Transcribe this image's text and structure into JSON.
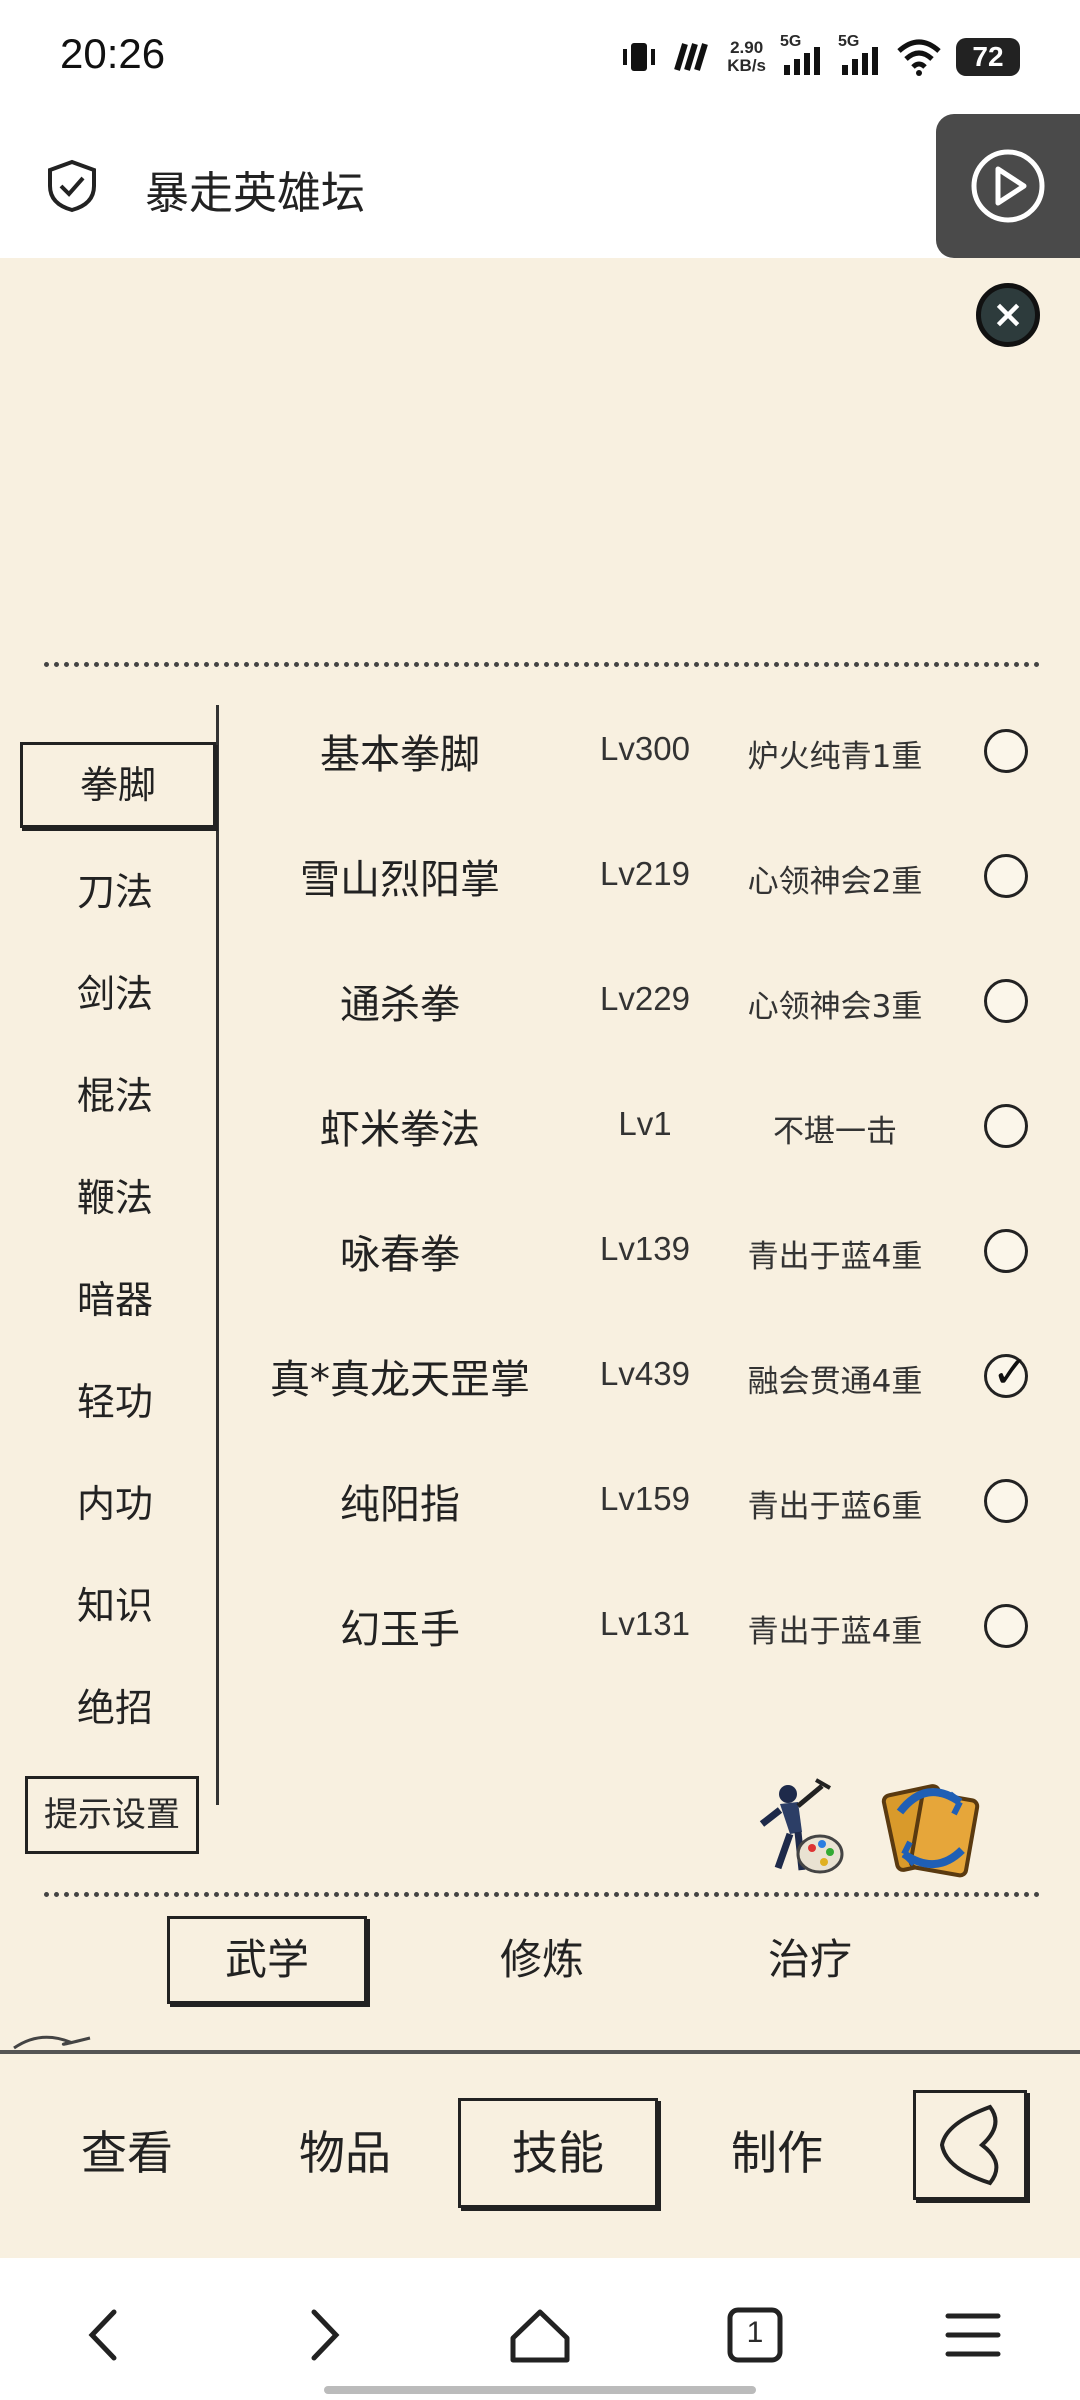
{
  "status_bar": {
    "time": "20:26",
    "net_speed": "2.90",
    "net_speed_unit": "KB/s",
    "signal1": "5G",
    "signal2": "5G",
    "battery": "72"
  },
  "app_bar": {
    "title": "暴走英雄坛",
    "icons": [
      "shield-check-icon",
      "play-circle-icon"
    ]
  },
  "categories": [
    {
      "label": "拳脚",
      "active": true
    },
    {
      "label": "刀法",
      "active": false
    },
    {
      "label": "剑法",
      "active": false
    },
    {
      "label": "棍法",
      "active": false
    },
    {
      "label": "鞭法",
      "active": false
    },
    {
      "label": "暗器",
      "active": false
    },
    {
      "label": "轻功",
      "active": false
    },
    {
      "label": "内功",
      "active": false
    },
    {
      "label": "知识",
      "active": false
    },
    {
      "label": "绝招",
      "active": false
    }
  ],
  "hint_settings_label": "提示设置",
  "skills": [
    {
      "name": "基本拳脚",
      "level": "Lv300",
      "rank": "炉火纯青1重",
      "checked": false
    },
    {
      "name": "雪山烈阳掌",
      "level": "Lv219",
      "rank": "心领神会2重",
      "checked": false
    },
    {
      "name": "通杀拳",
      "level": "Lv229",
      "rank": "心领神会3重",
      "checked": false
    },
    {
      "name": "虾米拳法",
      "level": "Lv1",
      "rank": "不堪一击",
      "checked": false
    },
    {
      "name": "咏春拳",
      "level": "Lv139",
      "rank": "青出于蓝4重",
      "checked": false
    },
    {
      "name": "真*真龙天罡掌",
      "level": "Lv439",
      "rank": "融会贯通4重",
      "checked": true
    },
    {
      "name": "纯阳指",
      "level": "Lv159",
      "rank": "青出于蓝6重",
      "checked": false
    },
    {
      "name": "幻玉手",
      "level": "Lv131",
      "rank": "青出于蓝4重",
      "checked": false
    }
  ],
  "sub_tabs": [
    {
      "label": "武学",
      "active": true
    },
    {
      "label": "修炼",
      "active": false
    },
    {
      "label": "治疗",
      "active": false
    }
  ],
  "bottom_tabs": [
    {
      "label": "查看",
      "active": false
    },
    {
      "label": "物品",
      "active": false
    },
    {
      "label": "技能",
      "active": true
    },
    {
      "label": "制作",
      "active": false
    }
  ],
  "browser_nav": {
    "tab_count": "1"
  }
}
